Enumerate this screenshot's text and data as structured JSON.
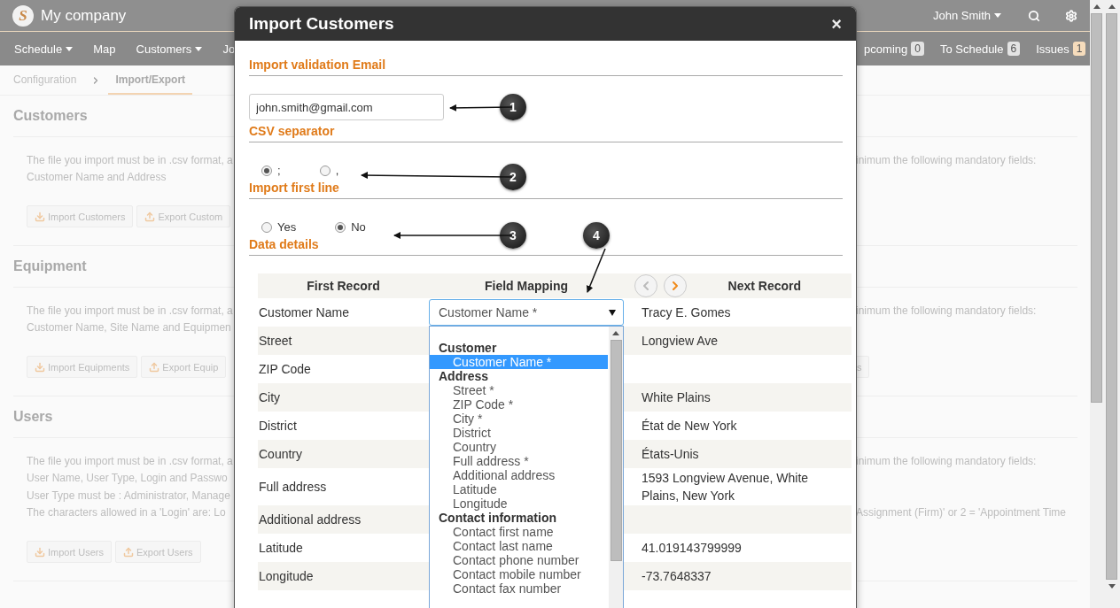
{
  "app": {
    "logo": "S",
    "company": "My company",
    "user": "John Smith",
    "nav": [
      {
        "label": "Schedule",
        "dropdown": true
      },
      {
        "label": "Map",
        "dropdown": false
      },
      {
        "label": "Customers",
        "dropdown": true
      },
      {
        "label": "Jo",
        "dropdown": false
      }
    ],
    "nav_right": [
      {
        "label": "pcoming",
        "badge": "0",
        "color": "#e3e3e3"
      },
      {
        "label": "To Schedule",
        "badge": "6",
        "color": "#e3e3e3"
      },
      {
        "label": "Issues",
        "badge": "1",
        "color": "#f6dcbc"
      }
    ],
    "breadcrumb": [
      {
        "label": "Configuration",
        "selected": false
      },
      {
        "label": "Import/Export",
        "selected": true
      }
    ],
    "sections": [
      {
        "title": "Customers",
        "lines": [
          {
            "left": "The file you import must be in .csv format, a",
            "right": "inimum the following mandatory fields:"
          },
          {
            "left": "Customer Name and Address"
          }
        ],
        "buttons": [
          {
            "kind": "import",
            "label": "Import Customers"
          },
          {
            "kind": "export",
            "label": "Export Custom"
          }
        ]
      },
      {
        "title": "Equipment",
        "lines": [
          {
            "left": "The file you import must be in .csv format, a",
            "right": "inimum the following mandatory fields:"
          },
          {
            "left": "Customer Name, Site Name and Equipmen"
          }
        ],
        "buttons": [
          {
            "kind": "import",
            "label": "Import Equipments"
          },
          {
            "kind": "export",
            "label": "Export Equip"
          }
        ],
        "right_button": "s"
      },
      {
        "title": "Users",
        "lines": [
          {
            "left": "The file you import must be in .csv format, a",
            "right": "inimum the following mandatory fields:"
          },
          {
            "left": "User Name, User Type, Login and Passwo"
          },
          {
            "left": "User Type must be : Administrator, Manage"
          },
          {
            "left": "The characters allowed in a 'Login' are: Lo",
            "right": "Assignment (Firm)' or 2 = 'Appointment Time"
          }
        ],
        "buttons": [
          {
            "kind": "import",
            "label": "Import Users"
          },
          {
            "kind": "export",
            "label": "Export Users"
          }
        ]
      }
    ]
  },
  "modal": {
    "title": "Import Customers",
    "close": "×",
    "email": {
      "heading": "Import validation Email",
      "value": "john.smith@gmail.com"
    },
    "separator": {
      "heading": "CSV separator",
      "options": [
        {
          "label": ";",
          "selected": true
        },
        {
          "label": ",",
          "selected": false
        }
      ]
    },
    "first_line": {
      "heading": "Import first line",
      "options": [
        {
          "label": "Yes",
          "selected": false
        },
        {
          "label": "No",
          "selected": true
        }
      ]
    },
    "data_details": {
      "heading": "Data details",
      "columns": [
        "First Record",
        "Field Mapping",
        "Next Record"
      ],
      "record_nav": [
        {
          "kind": "prev",
          "disabled": true
        },
        {
          "kind": "next",
          "disabled": false
        }
      ],
      "rows": [
        {
          "field": "Customer Name",
          "mapping": "Customer Name *",
          "next": "Tracy E. Gomes"
        },
        {
          "field": "Street",
          "next": "Longview Ave"
        },
        {
          "field": "ZIP Code"
        },
        {
          "field": "City",
          "next": "White Plains"
        },
        {
          "field": "District",
          "next": "État de New York"
        },
        {
          "field": "Country",
          "next": "États-Unis"
        },
        {
          "field": "Full address",
          "next": "1593 Longview Avenue, White Plains, New York"
        },
        {
          "field": "Additional address"
        },
        {
          "field": "Latitude",
          "next": "41.019143799999"
        },
        {
          "field": "Longitude",
          "next": "-73.7648337"
        }
      ],
      "dropdown": [
        {
          "label": "Customer",
          "options": [
            {
              "label": "Customer Name *",
              "selected": true
            }
          ]
        },
        {
          "label": "Address",
          "options": [
            {
              "label": "Street *",
              "selected": false
            },
            {
              "label": "ZIP Code *",
              "selected": false
            },
            {
              "label": "City *",
              "selected": false
            },
            {
              "label": "District",
              "selected": false
            },
            {
              "label": "Country",
              "selected": false
            },
            {
              "label": "Full address *",
              "selected": false
            },
            {
              "label": "Additional address",
              "selected": false
            },
            {
              "label": "Latitude",
              "selected": false
            },
            {
              "label": "Longitude",
              "selected": false
            }
          ]
        },
        {
          "label": "Contact information",
          "options": [
            {
              "label": "Contact first name",
              "selected": false
            },
            {
              "label": "Contact last name",
              "selected": false
            },
            {
              "label": "Contact phone number",
              "selected": false
            },
            {
              "label": "Contact mobile number",
              "selected": false
            },
            {
              "label": "Contact fax number",
              "selected": false
            }
          ]
        }
      ]
    },
    "callouts": [
      "1",
      "2",
      "3",
      "4"
    ]
  }
}
